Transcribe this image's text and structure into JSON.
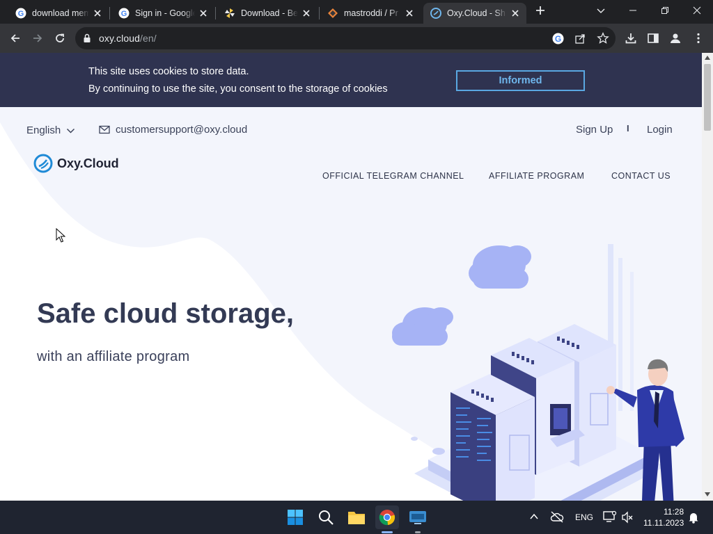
{
  "browser": {
    "tabs": [
      {
        "title": "download mem",
        "favicon": "google-icon",
        "active": false
      },
      {
        "title": "Sign in - Google",
        "favicon": "google-icon",
        "active": false
      },
      {
        "title": "Download - Be",
        "favicon": "pinwheel-icon",
        "active": false
      },
      {
        "title": "mastroddi / Pr",
        "favicon": "diamond-icon",
        "active": false
      },
      {
        "title": "Oxy.Cloud - Sh",
        "favicon": "oxy-icon",
        "active": true
      }
    ],
    "url_host": "oxy.cloud",
    "url_path": "/en/"
  },
  "cookie_banner": {
    "line1": "This site uses cookies to store data.",
    "line2": "By continuing to use the site, you consent to the storage of cookies",
    "button": "Informed"
  },
  "header": {
    "language": "English",
    "email": "customersupport@oxy.cloud",
    "signup": "Sign Up",
    "separator": "I",
    "login": "Login",
    "brand": "Oxy.Cloud",
    "nav": [
      "OFFICIAL TELEGRAM CHANNEL",
      "AFFILIATE PROGRAM",
      "CONTACT US"
    ]
  },
  "hero": {
    "title": "Safe cloud storage,",
    "subtitle": "with an affiliate program"
  },
  "taskbar": {
    "language": "ENG",
    "time": "11:28",
    "date": "11.11.2023"
  },
  "colors": {
    "banner_bg": "#2f3350",
    "button_accent": "#5aa8e2",
    "page_bg": "#f3f5fc",
    "title_text": "#333a54",
    "brand_blue": "#1f8ad6"
  }
}
